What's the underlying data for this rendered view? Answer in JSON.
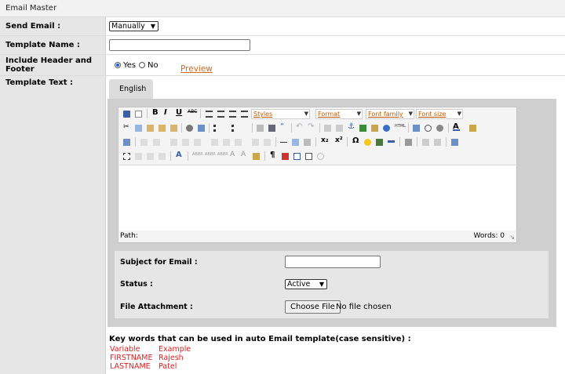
{
  "header": {
    "title": "Email Master"
  },
  "form": {
    "send_email": {
      "label": "Send Email :",
      "value": "Manually"
    },
    "template_name": {
      "label": "Template Name :",
      "value": ""
    },
    "include_header_footer": {
      "label": "Include Header and Footer",
      "options": [
        "Yes",
        "No"
      ],
      "selected": "Yes",
      "preview_link": "Preview"
    },
    "template_text": {
      "label": "Template Text :"
    }
  },
  "tabs": [
    {
      "label": "English",
      "active": true
    }
  ],
  "editor": {
    "dropdowns": {
      "styles": "Styles",
      "format": "Format",
      "font_family": "Font family",
      "font_size": "Font size"
    },
    "path_label": "Path:",
    "word_count": "Words: 0",
    "toolbar_icons": [
      "save-icon",
      "new-document-icon",
      "bold-icon",
      "italic-icon",
      "underline-icon",
      "strikethrough-icon",
      "align-left-icon",
      "align-center-icon",
      "align-right-icon",
      "justify-icon",
      "cut-icon",
      "copy-icon",
      "paste-icon",
      "paste-text-icon",
      "paste-word-icon",
      "find-icon",
      "replace-icon",
      "bullet-list-icon",
      "numbered-list-icon",
      "outdent-icon",
      "indent-icon",
      "blockquote-icon",
      "undo-icon",
      "redo-icon",
      "link-icon",
      "unlink-icon",
      "anchor-icon",
      "image-icon",
      "cleanup-icon",
      "help-icon",
      "html-icon",
      "insert-date-icon",
      "insert-time-icon",
      "preview-icon",
      "text-color-icon",
      "highlight-color-icon",
      "spellcheck-icon",
      "table-icon",
      "row-props-icon",
      "horizontal-rule-icon",
      "remove-format-icon",
      "visual-aid-icon",
      "subscript-icon",
      "superscript-icon",
      "special-char-icon",
      "emoticon-icon",
      "media-icon",
      "advanced-hr-icon",
      "print-icon",
      "ltr-icon",
      "rtl-icon",
      "fullscreen-icon",
      "insert-layer-icon",
      "style-props-icon",
      "citation-icon",
      "show-blocks-icon",
      "pilcrow-icon",
      "template-icon",
      "page-break-icon",
      "restore-draft-icon"
    ]
  },
  "email_fields": {
    "subject": {
      "label": "Subject for Email :",
      "value": ""
    },
    "status": {
      "label": "Status :",
      "value": "Active"
    },
    "attachment": {
      "label": "File Attachment :",
      "button": "Choose File",
      "text": "No file chosen"
    }
  },
  "keywords": {
    "heading": "Key words that can be used in auto Email template(case sensitive) :",
    "columns": [
      "Variable",
      "Example"
    ],
    "rows": [
      {
        "variable": "FIRSTNAME",
        "example": "Rajesh"
      },
      {
        "variable": "LASTNAME",
        "example": "Patel"
      }
    ]
  },
  "colors": {
    "label_bg": "#e6e6e6",
    "panel_bg": "#cfcfcf",
    "link": "#cc6a1c",
    "keyword": "#e02020"
  }
}
